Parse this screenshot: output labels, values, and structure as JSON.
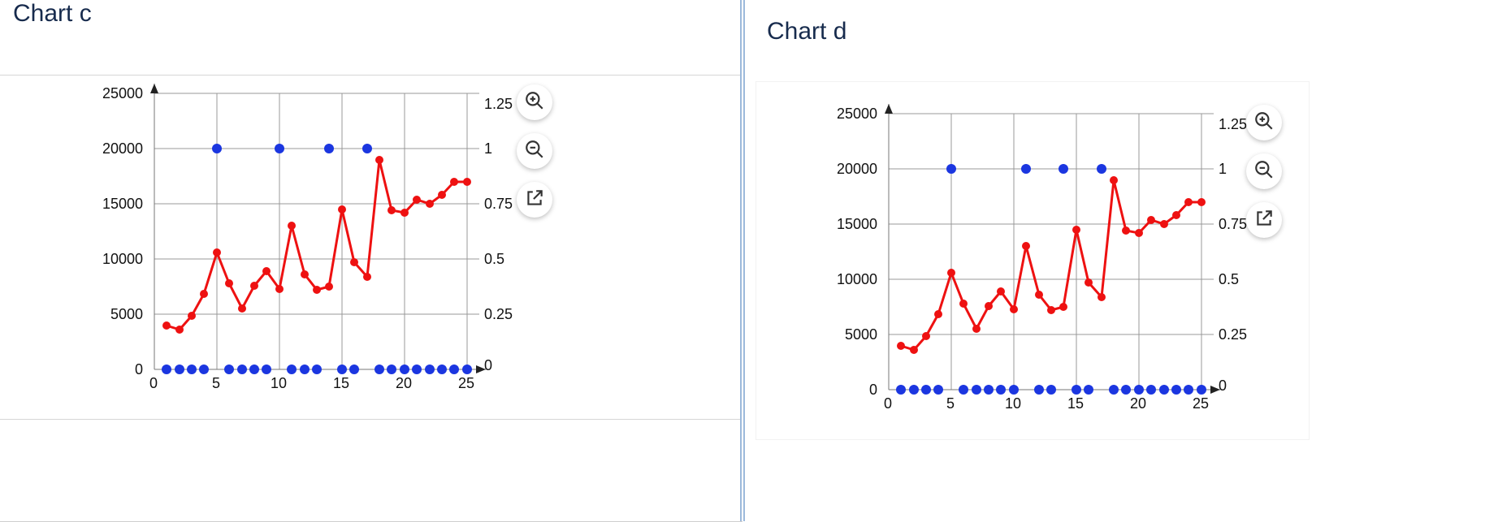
{
  "left": {
    "title": "Chart c",
    "toolbar": {
      "zoom_in": "Zoom in",
      "zoom_out": "Zoom out",
      "open": "Open"
    }
  },
  "right": {
    "title": "Chart d",
    "toolbar": {
      "zoom_in": "Zoom in",
      "zoom_out": "Zoom out",
      "open": "Open"
    }
  },
  "chart_data": [
    {
      "id": "c",
      "type": "line",
      "title": "Chart c",
      "x": [
        1,
        2,
        3,
        4,
        5,
        6,
        7,
        8,
        9,
        10,
        11,
        12,
        13,
        14,
        15,
        16,
        17,
        18,
        19,
        20,
        21,
        22,
        23,
        24,
        25
      ],
      "left_axis": {
        "label": "",
        "ticks": [
          0,
          5000,
          10000,
          15000,
          20000,
          25000
        ],
        "range": [
          0,
          25000
        ]
      },
      "right_axis": {
        "label": "",
        "ticks": [
          0,
          0.25,
          0.5,
          0.75,
          1,
          1.25
        ],
        "range": [
          0,
          1.25
        ]
      },
      "x_axis": {
        "label": "",
        "ticks": [
          0,
          5,
          10,
          15,
          20,
          25
        ],
        "range": [
          0,
          26
        ]
      },
      "series": [
        {
          "name": "red",
          "axis": "left",
          "style": "line-dots",
          "values": [
            4000,
            3600,
            4800,
            6800,
            10600,
            7800,
            5500,
            7600,
            8900,
            7300,
            13000,
            8600,
            7200,
            7500,
            14500,
            9700,
            8400,
            19000,
            14400,
            14200,
            15400,
            15000,
            15800,
            17000,
            17000
          ]
        },
        {
          "name": "blue",
          "axis": "right",
          "style": "dots",
          "values": [
            0,
            0,
            0,
            0,
            1,
            0,
            0,
            0,
            0,
            1,
            0,
            0,
            0,
            1,
            0,
            0,
            1,
            0,
            0,
            0,
            0,
            0,
            0,
            0,
            0
          ]
        }
      ]
    },
    {
      "id": "d",
      "type": "line",
      "title": "Chart d",
      "x": [
        1,
        2,
        3,
        4,
        5,
        6,
        7,
        8,
        9,
        10,
        11,
        12,
        13,
        14,
        15,
        16,
        17,
        18,
        19,
        20,
        21,
        22,
        23,
        24,
        25
      ],
      "left_axis": {
        "label": "",
        "ticks": [
          0,
          5000,
          10000,
          15000,
          20000,
          25000
        ],
        "range": [
          0,
          25000
        ]
      },
      "right_axis": {
        "label": "",
        "ticks": [
          0,
          0.25,
          0.5,
          0.75,
          1,
          1.25
        ],
        "range": [
          0,
          1.25
        ]
      },
      "x_axis": {
        "label": "",
        "ticks": [
          0,
          5,
          10,
          15,
          20,
          25
        ],
        "range": [
          0,
          26
        ]
      },
      "series": [
        {
          "name": "red",
          "axis": "left",
          "style": "line-dots",
          "values": [
            4000,
            3600,
            4800,
            6800,
            10600,
            7800,
            5500,
            7600,
            8900,
            7300,
            13000,
            8600,
            7200,
            7500,
            14500,
            9700,
            8400,
            19000,
            14400,
            14200,
            15400,
            15000,
            15800,
            17000,
            17000
          ]
        },
        {
          "name": "blue",
          "axis": "right",
          "style": "dots",
          "values": [
            0,
            0,
            0,
            0,
            1,
            0,
            0,
            0,
            0,
            0,
            1,
            0,
            0,
            1,
            0,
            0,
            1,
            0,
            0,
            0,
            0,
            0,
            0,
            0,
            0
          ]
        }
      ]
    }
  ]
}
